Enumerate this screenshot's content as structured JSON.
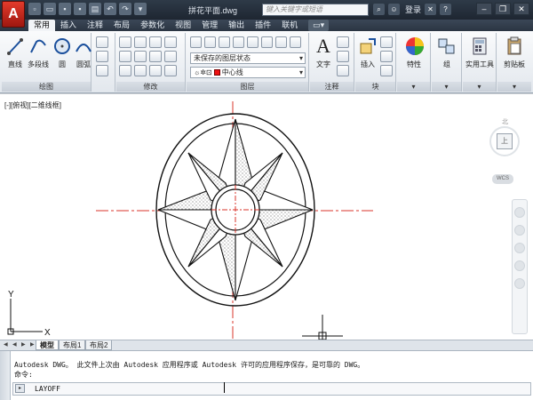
{
  "titlebar": {
    "logo": "A",
    "file_title": "拼花平面.dwg",
    "search_placeholder": "键入关键字或短语",
    "login_label": "登录"
  },
  "tabs": [
    "常用",
    "插入",
    "注释",
    "布局",
    "参数化",
    "视图",
    "管理",
    "输出",
    "插件",
    "联机"
  ],
  "ribbon": {
    "draw": {
      "label": "绘图",
      "tools": [
        "直线",
        "多段线",
        "圆",
        "圆弧"
      ]
    },
    "modify": {
      "label": "修改"
    },
    "layers": {
      "label": "图层",
      "layer_state": "未保存的图层状态",
      "current_layer": "中心线"
    },
    "annotation": {
      "label": "注释",
      "text_tool": "文字"
    },
    "block": {
      "label": "块",
      "insert_tool": "插入"
    },
    "properties": {
      "label": "特性"
    },
    "groups": {
      "label": "组"
    },
    "utilities": {
      "label": "实用工具"
    },
    "clipboard": {
      "label": "剪贴板"
    }
  },
  "viewport": {
    "label": "[-][俯视][二维线框]",
    "compass_north": "北",
    "cube_face": "上",
    "wcs": "WCS",
    "ucs_y": "Y",
    "ucs_x": "X"
  },
  "layout_tabs": [
    "模型",
    "布局1",
    "布局2"
  ],
  "command": {
    "history": [
      "Autodesk DWG。  此文件上次由 Autodesk 应用程序或 Autodesk 许可的应用程序保存，是可靠的 DWG。",
      "命令:"
    ],
    "input": "LAYOFF"
  },
  "colors": {
    "titlebar": "#1e2631",
    "app_red": "#c62a1e",
    "centerline_red": "#d9342b"
  }
}
